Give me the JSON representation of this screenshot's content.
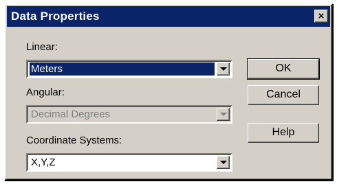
{
  "window": {
    "title": "Data Properties",
    "close_glyph": "×"
  },
  "fields": {
    "linear": {
      "label": "Linear:",
      "value": "Meters"
    },
    "angular": {
      "label": "Angular:",
      "value": "Decimal Degrees"
    },
    "coordinate": {
      "label": "Coordinate Systems:",
      "value": "X,Y,Z"
    }
  },
  "buttons": {
    "ok": "OK",
    "cancel": "Cancel",
    "help": "Help"
  },
  "colors": {
    "titlebar": "#0a246a",
    "face": "#d4d0c8",
    "selection": "#0a246a"
  }
}
